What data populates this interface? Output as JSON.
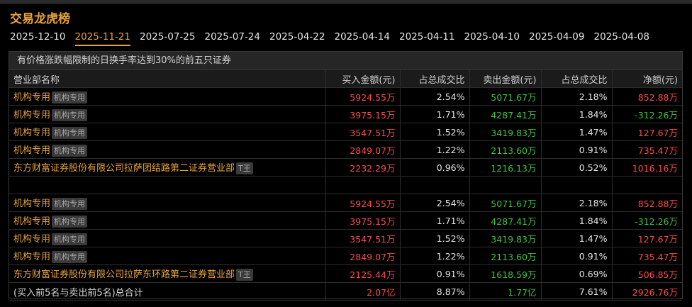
{
  "title": "交易龙虎榜",
  "tabs": [
    {
      "label": "2025-12-10"
    },
    {
      "label": "2025-11-21",
      "active": true
    },
    {
      "label": "2025-07-25"
    },
    {
      "label": "2025-07-24"
    },
    {
      "label": "2025-04-22"
    },
    {
      "label": "2025-04-14"
    },
    {
      "label": "2025-04-11"
    },
    {
      "label": "2025-04-10"
    },
    {
      "label": "2025-04-09"
    },
    {
      "label": "2025-04-08"
    }
  ],
  "table": {
    "caption": "有价格涨跌幅限制的日换手率达到30%的前五只证券",
    "headers": [
      "营业部名称",
      "买入金额(元)",
      "占总成交比",
      "卖出金额(元)",
      "占总成交比",
      "净额(元)"
    ],
    "buy_rows": [
      {
        "name": "机构专用",
        "tag": "机构专用",
        "buy": "5924.55万",
        "buy_pct": "2.54%",
        "sell": "5071.67万",
        "sell_pct": "2.18%",
        "net": "852.88万"
      },
      {
        "name": "机构专用",
        "tag": "机构专用",
        "buy": "3975.15万",
        "buy_pct": "1.71%",
        "sell": "4287.41万",
        "sell_pct": "1.84%",
        "net": "-312.26万"
      },
      {
        "name": "机构专用",
        "tag": "机构专用",
        "buy": "3547.51万",
        "buy_pct": "1.52%",
        "sell": "3419.83万",
        "sell_pct": "1.47%",
        "net": "127.67万"
      },
      {
        "name": "机构专用",
        "tag": "机构专用",
        "buy": "2849.07万",
        "buy_pct": "1.22%",
        "sell": "2113.60万",
        "sell_pct": "0.91%",
        "net": "735.47万"
      },
      {
        "name": "东方财富证券股份有限公司拉萨团结路第二证券营业部",
        "tag": "T王",
        "buy": "2232.29万",
        "buy_pct": "0.96%",
        "sell": "1216.13万",
        "sell_pct": "0.52%",
        "net": "1016.16万"
      }
    ],
    "sell_rows": [
      {
        "name": "机构专用",
        "tag": "机构专用",
        "buy": "5924.55万",
        "buy_pct": "2.54%",
        "sell": "5071.67万",
        "sell_pct": "2.18%",
        "net": "852.88万"
      },
      {
        "name": "机构专用",
        "tag": "机构专用",
        "buy": "3975.15万",
        "buy_pct": "1.71%",
        "sell": "4287.41万",
        "sell_pct": "1.84%",
        "net": "-312.26万"
      },
      {
        "name": "机构专用",
        "tag": "机构专用",
        "buy": "3547.51万",
        "buy_pct": "1.52%",
        "sell": "3419.83万",
        "sell_pct": "1.47%",
        "net": "127.67万"
      },
      {
        "name": "机构专用",
        "tag": "机构专用",
        "buy": "2849.07万",
        "buy_pct": "1.22%",
        "sell": "2113.60万",
        "sell_pct": "0.91%",
        "net": "735.47万"
      },
      {
        "name": "东方财富证券股份有限公司拉萨东环路第二证券营业部",
        "tag": "T王",
        "buy": "2125.44万",
        "buy_pct": "0.91%",
        "sell": "1618.59万",
        "sell_pct": "0.69%",
        "net": "506.85万"
      }
    ],
    "total": {
      "label": "(买入前5名与卖出前5名)总合计",
      "buy": "2.07亿",
      "buy_pct": "8.87%",
      "sell": "1.77亿",
      "sell_pct": "7.61%",
      "net": "2926.76万"
    }
  },
  "colors": {
    "accent": "#e8a33c",
    "buy": "#ff4a4a",
    "sell": "#3ec43e"
  }
}
